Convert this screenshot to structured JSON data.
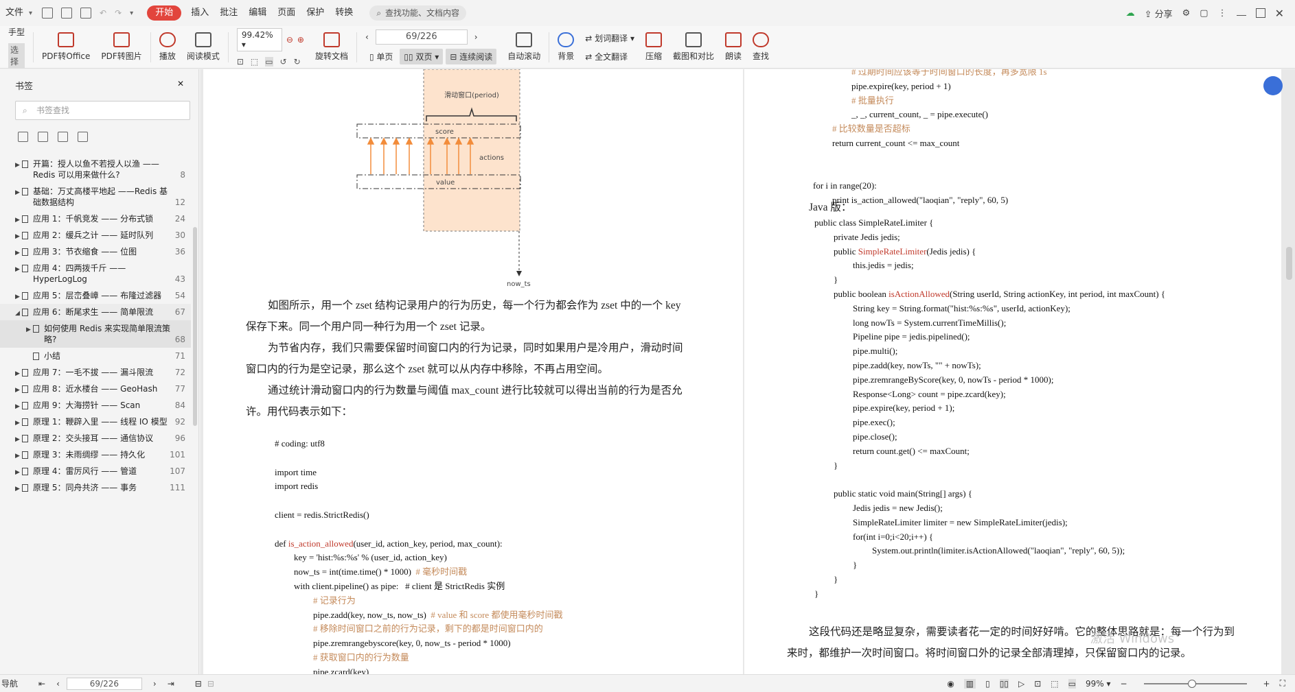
{
  "menu": {
    "file": "文件",
    "tabs": [
      "开始",
      "插入",
      "批注",
      "编辑",
      "页面",
      "保护",
      "转换"
    ],
    "search_placeholder": "查找功能、文档内容",
    "share": "分享"
  },
  "ribbon": {
    "hand": "手型",
    "select": "选择",
    "pdf_office": "PDF转Office",
    "pdf_image": "PDF转图片",
    "play": "播放",
    "read_mode": "阅读模式",
    "zoom": "99.42%",
    "rotate": "旋转文档",
    "page_value": "69/226",
    "single": "单页",
    "double": "双页",
    "continuous": "连续阅读",
    "auto_scroll": "自动滚动",
    "background": "背景",
    "word_translate": "划词翻译",
    "full_translate": "全文翻译",
    "compress": "压缩",
    "compare": "截图和对比",
    "read_aloud": "朗读",
    "find": "查找"
  },
  "sidebar": {
    "title": "书签",
    "search_placeholder": "书签查找",
    "items": [
      {
        "label": "开篇：授人以鱼不若授人以渔 —— Redis 可以用来做什么?",
        "page": "8",
        "level": 0
      },
      {
        "label": "基础：万丈高楼平地起 ——Redis 基础数据结构",
        "page": "12",
        "level": 0
      },
      {
        "label": "应用 1：千帆竞发 —— 分布式锁",
        "page": "24",
        "level": 0
      },
      {
        "label": "应用 2：缓兵之计 —— 延时队列",
        "page": "30",
        "level": 0
      },
      {
        "label": "应用 3：节衣缩食 —— 位图",
        "page": "36",
        "level": 0
      },
      {
        "label": "应用 4：四两拨千斤 —— HyperLogLog",
        "page": "43",
        "level": 0
      },
      {
        "label": "应用 5：层峦叠嶂 —— 布隆过滤器",
        "page": "54",
        "level": 0
      },
      {
        "label": "应用 6：断尾求生 —— 简单限流",
        "page": "67",
        "level": 0,
        "open": true
      },
      {
        "label": "如何使用 Redis 来实现简单限流策略?",
        "page": "68",
        "level": 1,
        "selected": true
      },
      {
        "label": "小结",
        "page": "71",
        "level": 1
      },
      {
        "label": "应用 7：一毛不拔 —— 漏斗限流",
        "page": "72",
        "level": 0
      },
      {
        "label": "应用 8：近水楼台 —— GeoHash",
        "page": "77",
        "level": 0
      },
      {
        "label": "应用 9：大海捞针 —— Scan",
        "page": "84",
        "level": 0
      },
      {
        "label": "原理 1：鞭辟入里 —— 线程 IO 模型",
        "page": "92",
        "level": 0
      },
      {
        "label": "原理 2：交头接耳 —— 通信协议",
        "page": "96",
        "level": 0
      },
      {
        "label": "原理 3：未雨绸缪 —— 持久化",
        "page": "101",
        "level": 0
      },
      {
        "label": "原理 4：雷厉风行 —— 管道",
        "page": "107",
        "level": 0
      },
      {
        "label": "原理 5：同舟共济 —— 事务",
        "page": "111",
        "level": 0
      }
    ]
  },
  "diagram": {
    "window_label": "滑动窗口(period)",
    "score_label": "score",
    "actions_label": "actions",
    "value_label": "value",
    "now_label": "now_ts"
  },
  "left_page": {
    "para1": "如图所示，用一个 zset 结构记录用户的行为历史，每一个行为都会作为 zset 中的一个 key 保存下来。同一个用户同一种行为用一个 zset 记录。",
    "para2": "为节省内存，我们只需要保留时间窗口内的行为记录，同时如果用户是冷用户，滑动时间窗口内的行为是空记录，那么这个 zset 就可以从内存中移除，不再占用空间。",
    "para3": "通过统计滑动窗口内的行为数量与阈值 max_count 进行比较就可以得出当前的行为是否允许。用代码表示如下：",
    "code": [
      {
        "indent": 0,
        "text": "# coding: utf8"
      },
      {
        "indent": 0,
        "text": ""
      },
      {
        "indent": 0,
        "text": "import time"
      },
      {
        "indent": 0,
        "text": "import redis"
      },
      {
        "indent": 0,
        "text": ""
      },
      {
        "indent": 0,
        "text": "client = redis.StrictRedis()"
      },
      {
        "indent": 0,
        "text": ""
      },
      {
        "indent": 0,
        "text": "def ",
        "red": "is_action_allowed",
        "rest": "(user_id, action_key, period, max_count):"
      },
      {
        "indent": 1,
        "text": "key = 'hist:%s:%s' % (user_id, action_key)"
      },
      {
        "indent": 1,
        "text": "now_ts = int(time.time() * 1000)  ",
        "comment": "# 毫秒时间戳"
      },
      {
        "indent": 1,
        "text": "with client.pipeline() as pipe:   # client 是 StrictRedis 实例"
      },
      {
        "indent": 2,
        "text": "",
        "comment": "# 记录行为"
      },
      {
        "indent": 2,
        "text": "pipe.zadd(key, now_ts, now_ts)  ",
        "comment": "# value 和 score 都使用毫秒时间戳"
      },
      {
        "indent": 2,
        "text": "",
        "comment": "# 移除时间窗口之前的行为记录，剩下的都是时间窗口内的"
      },
      {
        "indent": 2,
        "text": "pipe.zremrangebyscore(key, 0, now_ts - period * 1000)"
      },
      {
        "indent": 2,
        "text": "",
        "comment": "# 获取窗口内的行为数量"
      },
      {
        "indent": 2,
        "text": "pipe.zcard(key)"
      }
    ]
  },
  "right_page": {
    "code1": [
      {
        "indent": 2,
        "text": "",
        "comment": "# 过期时间应该等于时间窗口的长度，再多宽限 1s"
      },
      {
        "indent": 2,
        "text": "pipe.expire(key, period + 1)"
      },
      {
        "indent": 2,
        "text": "",
        "comment": "# 批量执行"
      },
      {
        "indent": 2,
        "text": "_, _, current_count, _ = pipe.execute()"
      },
      {
        "indent": 1,
        "text": "",
        "comment": "# 比较数量是否超标"
      },
      {
        "indent": 1,
        "text": "return current_count <= max_count"
      },
      {
        "indent": 0,
        "text": ""
      },
      {
        "indent": 0,
        "text": ""
      },
      {
        "indent": 0,
        "text": "for i in range(20):"
      },
      {
        "indent": 1,
        "text": "print is_action_allowed(\"laoqian\", \"reply\", 60, 5)"
      }
    ],
    "java_label": "Java 版：",
    "code2": [
      {
        "indent": 0,
        "text": "public class SimpleRateLimiter {"
      },
      {
        "indent": 1,
        "text": "private Jedis jedis;"
      },
      {
        "indent": 1,
        "text": "public ",
        "red": "SimpleRateLimiter",
        "rest": "(Jedis jedis) {"
      },
      {
        "indent": 2,
        "text": "this.jedis = jedis;"
      },
      {
        "indent": 1,
        "text": "}"
      },
      {
        "indent": 1,
        "text": "public boolean ",
        "red": "isActionAllowed",
        "rest": "(String userId, String actionKey, int period, int maxCount) {"
      },
      {
        "indent": 2,
        "text": "String key = String.format(\"hist:%s:%s\", userId, actionKey);"
      },
      {
        "indent": 2,
        "text": "long nowTs = System.currentTimeMillis();"
      },
      {
        "indent": 2,
        "text": "Pipeline pipe = jedis.pipelined();"
      },
      {
        "indent": 2,
        "text": "pipe.multi();"
      },
      {
        "indent": 2,
        "text": "pipe.zadd(key, nowTs, \"\" + nowTs);"
      },
      {
        "indent": 2,
        "text": "pipe.zremrangeByScore(key, 0, nowTs - period * 1000);"
      },
      {
        "indent": 2,
        "text": "Response<Long> count = pipe.zcard(key);"
      },
      {
        "indent": 2,
        "text": "pipe.expire(key, period + 1);"
      },
      {
        "indent": 2,
        "text": "pipe.exec();"
      },
      {
        "indent": 2,
        "text": "pipe.close();"
      },
      {
        "indent": 2,
        "text": "return count.get() <= maxCount;"
      },
      {
        "indent": 1,
        "text": "}"
      },
      {
        "indent": 0,
        "text": ""
      },
      {
        "indent": 1,
        "text": "public static void main(String[] args) {"
      },
      {
        "indent": 2,
        "text": "Jedis jedis = new Jedis();"
      },
      {
        "indent": 2,
        "text": "SimpleRateLimiter limiter = new SimpleRateLimiter(jedis);"
      },
      {
        "indent": 2,
        "text": "for(int i=0;i<20;i++) {"
      },
      {
        "indent": 3,
        "text": "System.out.println(limiter.isActionAllowed(\"laoqian\", \"reply\", 60, 5));"
      },
      {
        "indent": 2,
        "text": "}"
      },
      {
        "indent": 1,
        "text": "}"
      },
      {
        "indent": 0,
        "text": "}"
      }
    ],
    "para": "这段代码还是略显复杂，需要读者花一定的时间好好啃。它的整体思路就是：每一个行为到来时，都维护一次时间窗口。将时间窗口外的记录全部清理掉，只保留窗口内的记录。",
    "watermark": "激活 Windows"
  },
  "status": {
    "nav": "导航",
    "page": "69/226",
    "zoom": "99%"
  }
}
